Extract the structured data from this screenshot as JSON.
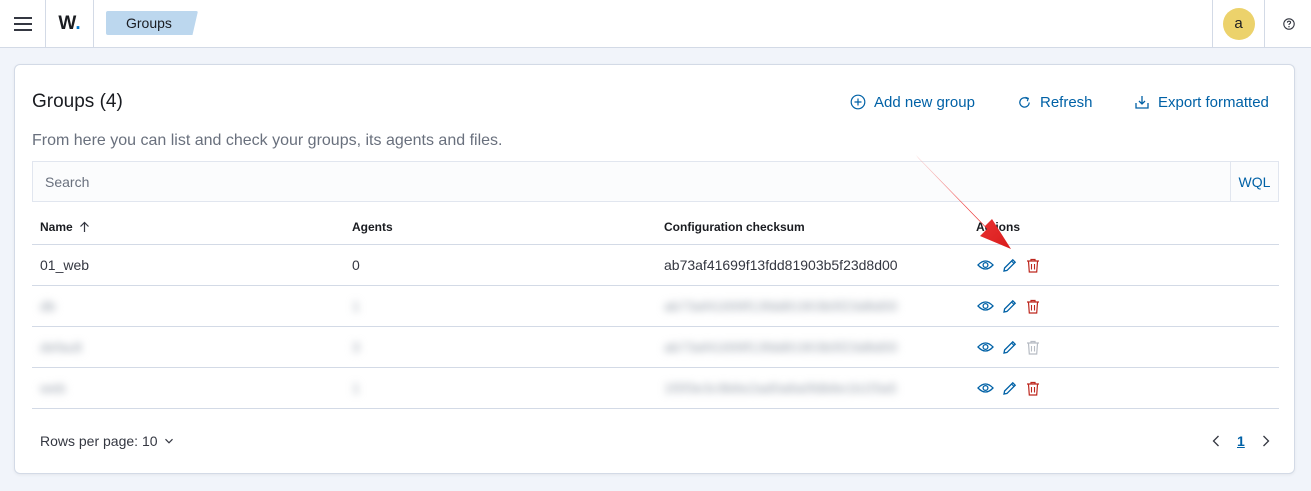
{
  "header": {
    "menu_icon": "hamburger-icon",
    "logo_text": "W",
    "logo_dot": ".",
    "breadcrumb": "Groups",
    "avatar_initial": "a",
    "help_icon": "help-circle-icon"
  },
  "panel": {
    "title": "Groups (4)",
    "description": "From here you can list and check your groups, its agents and files.",
    "buttons": {
      "add_new_group": "Add new group",
      "refresh": "Refresh",
      "export": "Export formatted"
    },
    "search": {
      "placeholder": "Search",
      "value": "",
      "wql_label": "WQL"
    }
  },
  "table": {
    "columns": {
      "name": "Name",
      "agents": "Agents",
      "checksum": "Configuration checksum",
      "actions": "Actions"
    },
    "sort_indicator": "arrow-up-icon",
    "rows": [
      {
        "name": "01_web",
        "agents": "0",
        "checksum": "ab73af41699f13fdd81903b5f23d8d00",
        "blurred": false,
        "delete_enabled": true
      },
      {
        "name": "db",
        "agents": "1",
        "checksum": "ab73af41699f13fdd81903b5f23d8d00",
        "blurred": true,
        "delete_enabled": true
      },
      {
        "name": "default",
        "agents": "3",
        "checksum": "ab73af41699f13fdd81903b5f23d8d00",
        "blurred": true,
        "delete_enabled": false
      },
      {
        "name": "web",
        "agents": "1",
        "checksum": "1f0f3e3c9b6e2ad0a8a0fdb6e1b1f3a5",
        "blurred": true,
        "delete_enabled": true
      }
    ],
    "action_icons": [
      "eye-icon",
      "pencil-icon",
      "trash-icon"
    ]
  },
  "pagination": {
    "rows_per_page_label": "Rows per page: 10",
    "current_page": "1"
  },
  "colors": {
    "link": "#0061a6",
    "delete": "#bd271e",
    "annotation_arrow": "#e8262a"
  }
}
